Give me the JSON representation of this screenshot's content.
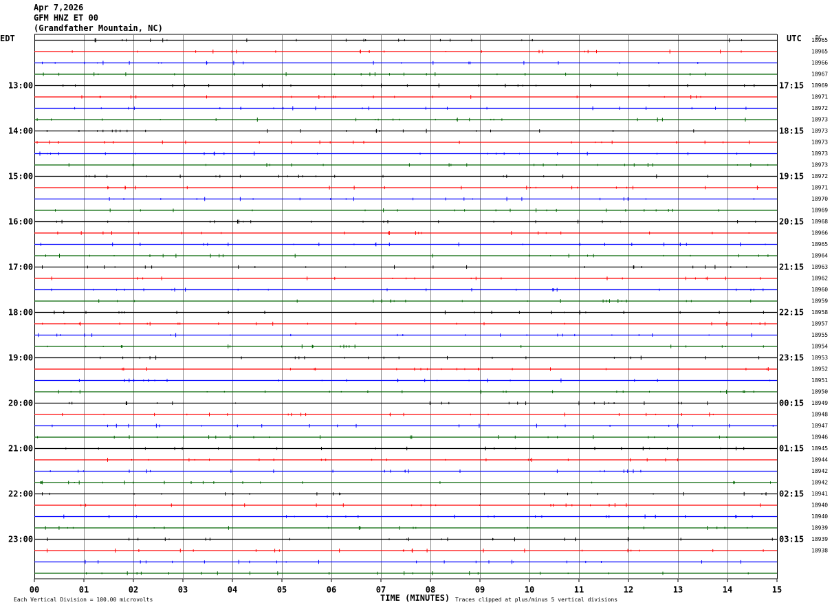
{
  "header": {
    "date": "Apr 7,2026",
    "station": "GFM HNZ ET 00",
    "location": "(Grandfather Mountain, NC)"
  },
  "labels": {
    "left_timezone": "EDT",
    "right_timezone": "UTC",
    "dc_label": "DC",
    "x_axis_title": "TIME (MINUTES)",
    "scale_note": "Each Vertical Division =  100.00 microvolts",
    "clip_note": "Traces clipped at plus/minus 5 vertical divisions"
  },
  "chart_data": {
    "type": "line",
    "title": "GFM HNZ ET 00",
    "xlabel": "TIME (MINUTES)",
    "xlim": [
      0,
      15
    ],
    "x_ticks": [
      "00",
      "01",
      "02",
      "03",
      "04",
      "05",
      "06",
      "07",
      "08",
      "09",
      "10",
      "11",
      "12",
      "13",
      "14",
      "15"
    ],
    "row_count": 48,
    "trace_colors": [
      "#000000",
      "#ff0000",
      "#0000ff",
      "#006400"
    ],
    "hour_labels_left": [
      "13:00",
      "14:00",
      "15:00",
      "16:00",
      "17:00",
      "18:00",
      "19:00",
      "20:00",
      "21:00",
      "22:00",
      "23:00"
    ],
    "hour_labels_right": [
      "17:15",
      "18:15",
      "19:15",
      "20:15",
      "21:15",
      "22:15",
      "23:15",
      "00:15",
      "01:15",
      "02:15",
      "03:15"
    ],
    "dc_offsets": [
      "18965",
      "18965",
      "18966",
      "18967",
      "18969",
      "18971",
      "18972",
      "18973",
      "18973",
      "18973",
      "18973",
      "18973",
      "18972",
      "18971",
      "18970",
      "18969",
      "18968",
      "18966",
      "18965",
      "18964",
      "18963",
      "18962",
      "18960",
      "18959",
      "18958",
      "18957",
      "18955",
      "18954",
      "18953",
      "18952",
      "18951",
      "18950",
      "18949",
      "18948",
      "18947",
      "18946",
      "18945",
      "18944",
      "18942",
      "18942",
      "18941",
      "18940",
      "18940",
      "18939",
      "18939",
      "18938"
    ]
  }
}
